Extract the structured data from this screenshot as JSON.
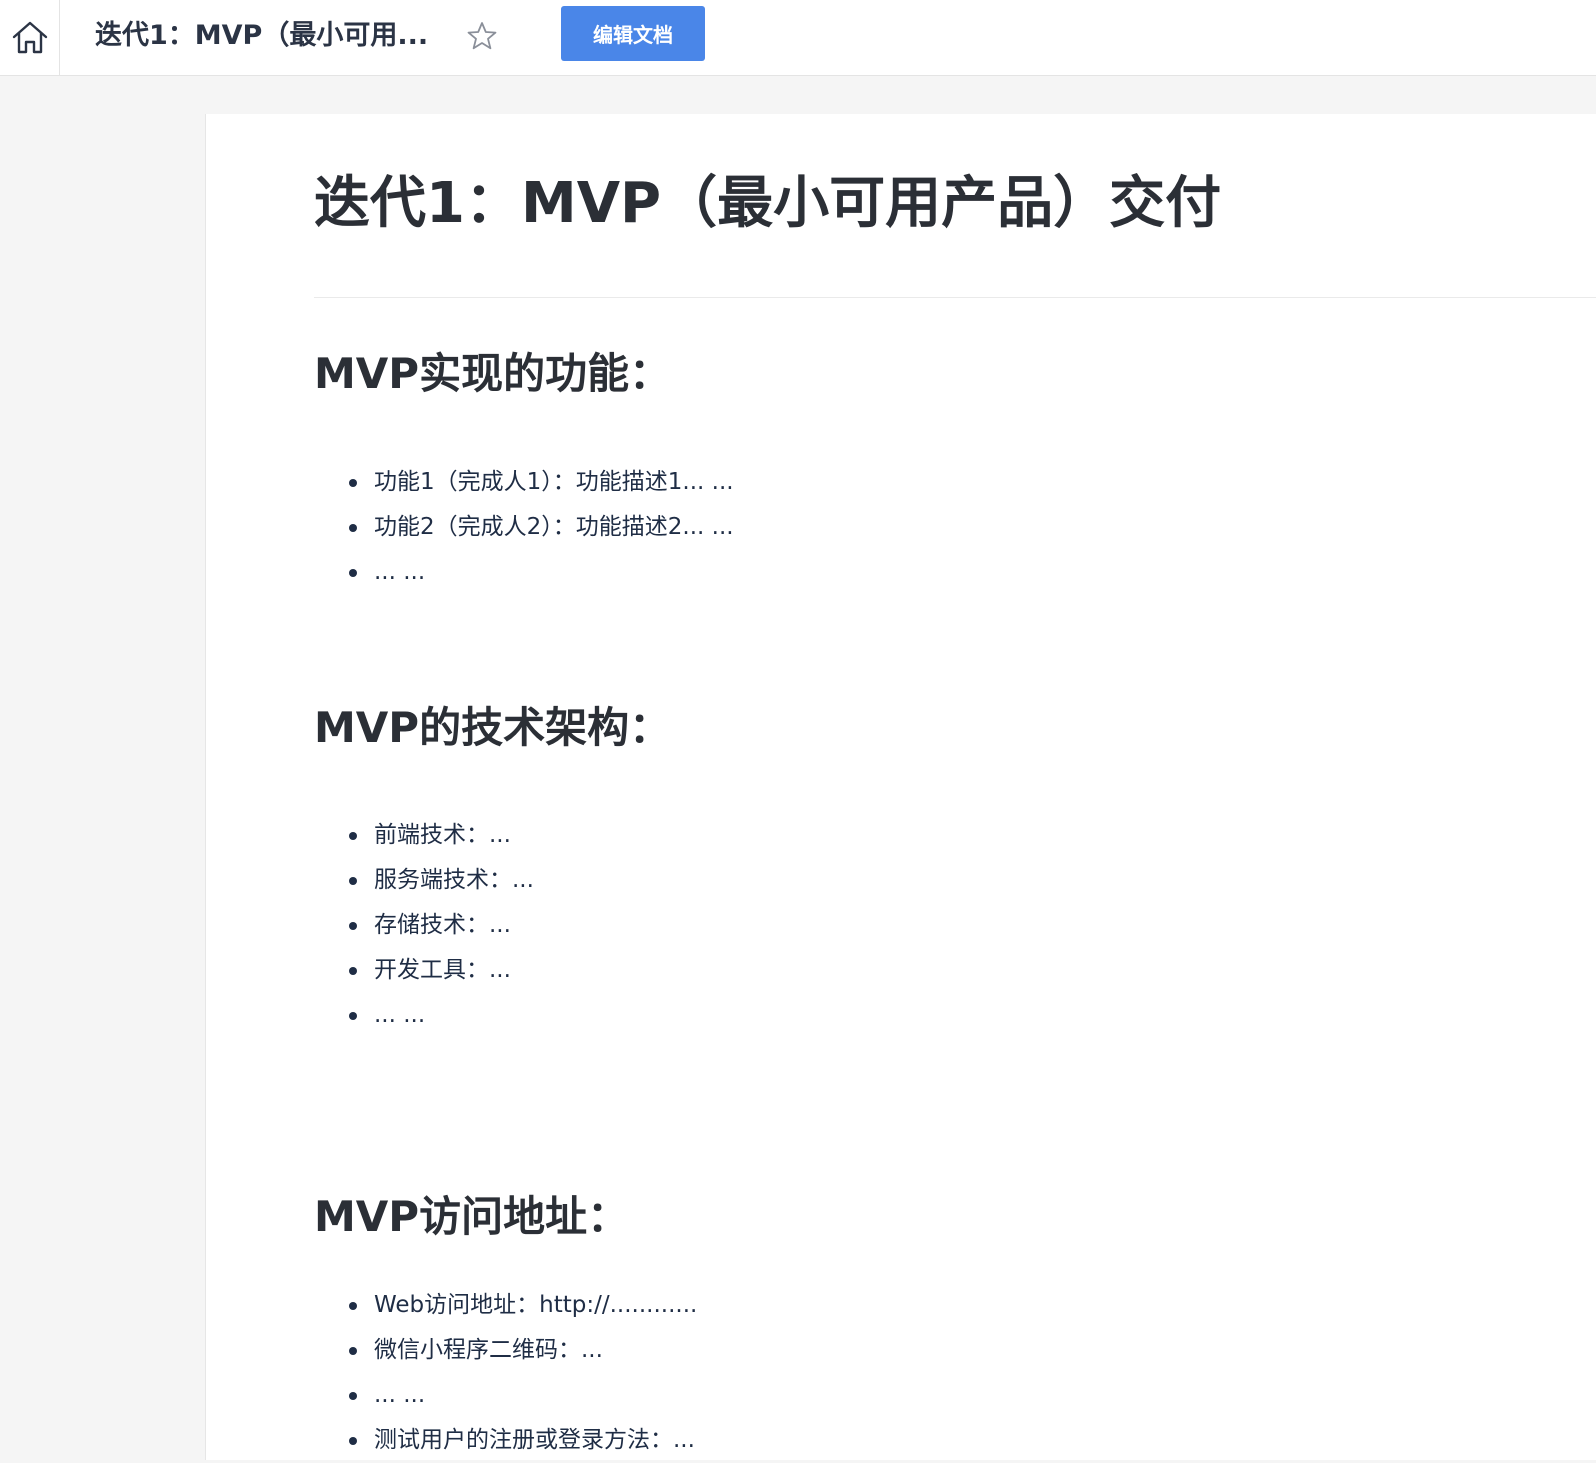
{
  "header": {
    "title": "迭代1：MVP（最小可用...",
    "edit_label": "编辑文档",
    "icons": {
      "home": "home-icon",
      "star": "star-outline-icon"
    }
  },
  "document": {
    "title": "迭代1：MVP（最小可用产品）交付",
    "sections": [
      {
        "heading": "MVP实现的功能：",
        "items": [
          "功能1（完成人1）：功能描述1... ...",
          "功能2（完成人2）：功能描述2... ...",
          "... ..."
        ]
      },
      {
        "heading": "MVP的技术架构：",
        "items": [
          "前端技术：...",
          "服务端技术：...",
          "存储技术：...",
          "开发工具：...",
          "... ..."
        ]
      },
      {
        "heading": "MVP访问地址：",
        "items": [
          "Web访问地址：http://............",
          "微信小程序二维码：...",
          "... ...",
          "测试用户的注册或登录方法：..."
        ]
      }
    ]
  },
  "colors": {
    "accent": "#4a86e8",
    "text": "#1f2d45",
    "heading": "#2b2f36",
    "background": "#f5f5f5"
  }
}
